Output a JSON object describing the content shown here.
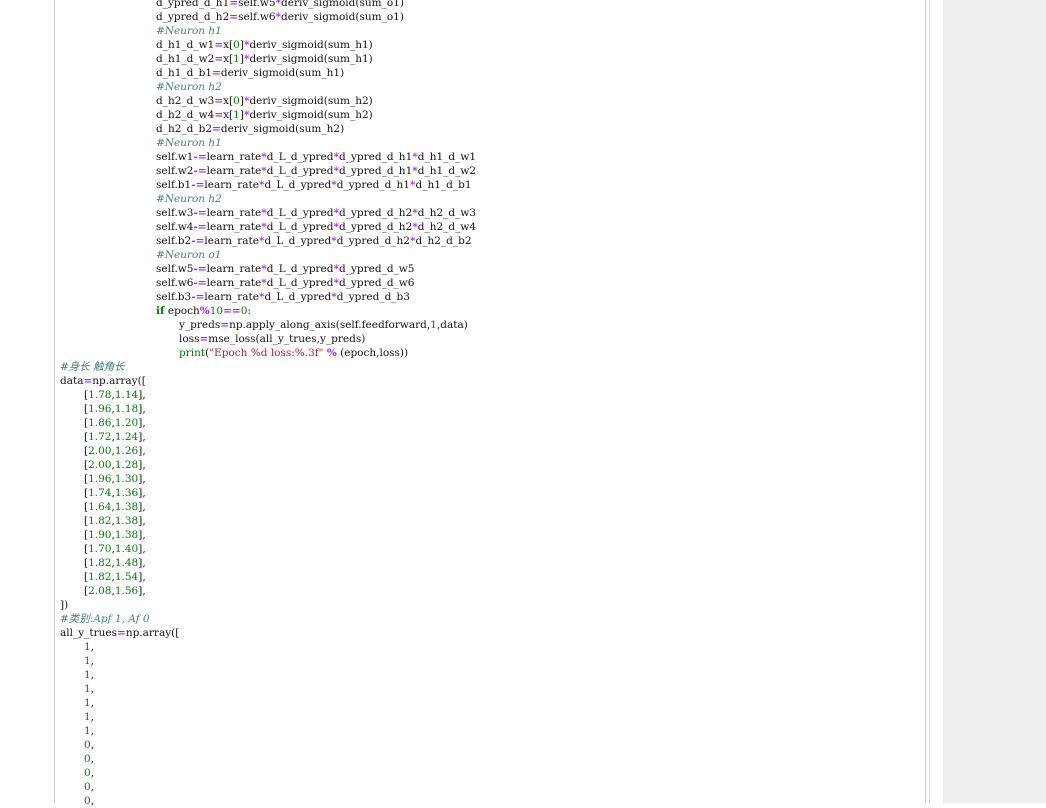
{
  "code_lines": [
    {
      "indent": 4,
      "tokens": [
        {
          "t": "d_ypred_d_h1",
          "c": ""
        },
        {
          "t": "=",
          "c": "op"
        },
        {
          "t": "self.w5",
          "c": ""
        },
        {
          "t": "*",
          "c": "op"
        },
        {
          "t": "deriv_sigmoid(sum_o1)",
          "c": ""
        }
      ]
    },
    {
      "indent": 4,
      "tokens": [
        {
          "t": "d_ypred_d_h2",
          "c": ""
        },
        {
          "t": "=",
          "c": "op"
        },
        {
          "t": "self.w6",
          "c": ""
        },
        {
          "t": "*",
          "c": "op"
        },
        {
          "t": "deriv_sigmoid(sum_o1)",
          "c": ""
        }
      ]
    },
    {
      "indent": 4,
      "tokens": [
        {
          "t": "#Neuron h1",
          "c": "cmt"
        }
      ]
    },
    {
      "indent": 4,
      "tokens": [
        {
          "t": "d_h1_d_w1",
          "c": ""
        },
        {
          "t": "=",
          "c": "op"
        },
        {
          "t": "x[",
          "c": ""
        },
        {
          "t": "0",
          "c": "num"
        },
        {
          "t": "]",
          "c": ""
        },
        {
          "t": "*",
          "c": "op"
        },
        {
          "t": "deriv_sigmoid(sum_h1)",
          "c": ""
        }
      ]
    },
    {
      "indent": 4,
      "tokens": [
        {
          "t": "d_h1_d_w2",
          "c": ""
        },
        {
          "t": "=",
          "c": "op"
        },
        {
          "t": "x[",
          "c": ""
        },
        {
          "t": "1",
          "c": "num"
        },
        {
          "t": "]",
          "c": ""
        },
        {
          "t": "*",
          "c": "op"
        },
        {
          "t": "deriv_sigmoid(sum_h1)",
          "c": ""
        }
      ]
    },
    {
      "indent": 4,
      "tokens": [
        {
          "t": "d_h1_d_b1",
          "c": ""
        },
        {
          "t": "=",
          "c": "op"
        },
        {
          "t": "deriv_sigmoid(sum_h1)",
          "c": ""
        }
      ]
    },
    {
      "indent": 4,
      "tokens": [
        {
          "t": "#Neuron h2",
          "c": "cmt"
        }
      ]
    },
    {
      "indent": 4,
      "tokens": [
        {
          "t": "d_h2_d_w3",
          "c": ""
        },
        {
          "t": "=",
          "c": "op"
        },
        {
          "t": "x[",
          "c": ""
        },
        {
          "t": "0",
          "c": "num"
        },
        {
          "t": "]",
          "c": ""
        },
        {
          "t": "*",
          "c": "op"
        },
        {
          "t": "deriv_sigmoid(sum_h2)",
          "c": ""
        }
      ]
    },
    {
      "indent": 4,
      "tokens": [
        {
          "t": "d_h2_d_w4",
          "c": ""
        },
        {
          "t": "=",
          "c": "op"
        },
        {
          "t": "x[",
          "c": ""
        },
        {
          "t": "1",
          "c": "num"
        },
        {
          "t": "]",
          "c": ""
        },
        {
          "t": "*",
          "c": "op"
        },
        {
          "t": "deriv_sigmoid(sum_h2)",
          "c": ""
        }
      ]
    },
    {
      "indent": 4,
      "tokens": [
        {
          "t": "d_h2_d_b2",
          "c": ""
        },
        {
          "t": "=",
          "c": "op"
        },
        {
          "t": "deriv_sigmoid(sum_h2)",
          "c": ""
        }
      ]
    },
    {
      "indent": 4,
      "tokens": [
        {
          "t": "#Neuron h1",
          "c": "cmt"
        }
      ]
    },
    {
      "indent": 4,
      "tokens": [
        {
          "t": "self.w1",
          "c": ""
        },
        {
          "t": "-=",
          "c": "op"
        },
        {
          "t": "learn_rate",
          "c": ""
        },
        {
          "t": "*",
          "c": "op"
        },
        {
          "t": "d_L_d_ypred",
          "c": ""
        },
        {
          "t": "*",
          "c": "op"
        },
        {
          "t": "d_ypred_d_h1",
          "c": ""
        },
        {
          "t": "*",
          "c": "op"
        },
        {
          "t": "d_h1_d_w1",
          "c": ""
        }
      ]
    },
    {
      "indent": 4,
      "tokens": [
        {
          "t": "self.w2",
          "c": ""
        },
        {
          "t": "-=",
          "c": "op"
        },
        {
          "t": "learn_rate",
          "c": ""
        },
        {
          "t": "*",
          "c": "op"
        },
        {
          "t": "d_L_d_ypred",
          "c": ""
        },
        {
          "t": "*",
          "c": "op"
        },
        {
          "t": "d_ypred_d_h1",
          "c": ""
        },
        {
          "t": "*",
          "c": "op"
        },
        {
          "t": "d_h1_d_w2",
          "c": ""
        }
      ]
    },
    {
      "indent": 4,
      "tokens": [
        {
          "t": "self.b1",
          "c": ""
        },
        {
          "t": "-=",
          "c": "op"
        },
        {
          "t": "learn_rate",
          "c": ""
        },
        {
          "t": "*",
          "c": "op"
        },
        {
          "t": "d_L_d_ypred",
          "c": ""
        },
        {
          "t": "*",
          "c": "op"
        },
        {
          "t": "d_ypred_d_h1",
          "c": ""
        },
        {
          "t": "*",
          "c": "op"
        },
        {
          "t": "d_h1_d_b1",
          "c": ""
        }
      ]
    },
    {
      "indent": 4,
      "tokens": [
        {
          "t": "#Neuron h2",
          "c": "cmt"
        }
      ]
    },
    {
      "indent": 4,
      "tokens": [
        {
          "t": "self.w3",
          "c": ""
        },
        {
          "t": "-=",
          "c": "op"
        },
        {
          "t": "learn_rate",
          "c": ""
        },
        {
          "t": "*",
          "c": "op"
        },
        {
          "t": "d_L_d_ypred",
          "c": ""
        },
        {
          "t": "*",
          "c": "op"
        },
        {
          "t": "d_ypred_d_h2",
          "c": ""
        },
        {
          "t": "*",
          "c": "op"
        },
        {
          "t": "d_h2_d_w3",
          "c": ""
        }
      ]
    },
    {
      "indent": 4,
      "tokens": [
        {
          "t": "self.w4",
          "c": ""
        },
        {
          "t": "-=",
          "c": "op"
        },
        {
          "t": "learn_rate",
          "c": ""
        },
        {
          "t": "*",
          "c": "op"
        },
        {
          "t": "d_L_d_ypred",
          "c": ""
        },
        {
          "t": "*",
          "c": "op"
        },
        {
          "t": "d_ypred_d_h2",
          "c": ""
        },
        {
          "t": "*",
          "c": "op"
        },
        {
          "t": "d_h2_d_w4",
          "c": ""
        }
      ]
    },
    {
      "indent": 4,
      "tokens": [
        {
          "t": "self.b2",
          "c": ""
        },
        {
          "t": "-=",
          "c": "op"
        },
        {
          "t": "learn_rate",
          "c": ""
        },
        {
          "t": "*",
          "c": "op"
        },
        {
          "t": "d_L_d_ypred",
          "c": ""
        },
        {
          "t": "*",
          "c": "op"
        },
        {
          "t": "d_ypred_d_h2",
          "c": ""
        },
        {
          "t": "*",
          "c": "op"
        },
        {
          "t": "d_h2_d_b2",
          "c": ""
        }
      ]
    },
    {
      "indent": 4,
      "tokens": [
        {
          "t": "#Neuron o1",
          "c": "cmt"
        }
      ]
    },
    {
      "indent": 4,
      "tokens": [
        {
          "t": "self.w5",
          "c": ""
        },
        {
          "t": "-=",
          "c": "op"
        },
        {
          "t": "learn_rate",
          "c": ""
        },
        {
          "t": "*",
          "c": "op"
        },
        {
          "t": "d_L_d_ypred",
          "c": ""
        },
        {
          "t": "*",
          "c": "op"
        },
        {
          "t": "d_ypred_d_w5",
          "c": ""
        }
      ]
    },
    {
      "indent": 4,
      "tokens": [
        {
          "t": "self.w6",
          "c": ""
        },
        {
          "t": "-=",
          "c": "op"
        },
        {
          "t": "learn_rate",
          "c": ""
        },
        {
          "t": "*",
          "c": "op"
        },
        {
          "t": "d_L_d_ypred",
          "c": ""
        },
        {
          "t": "*",
          "c": "op"
        },
        {
          "t": "d_ypred_d_w6",
          "c": ""
        }
      ]
    },
    {
      "indent": 4,
      "tokens": [
        {
          "t": "self.b3",
          "c": ""
        },
        {
          "t": "-=",
          "c": "op"
        },
        {
          "t": "learn_rate",
          "c": ""
        },
        {
          "t": "*",
          "c": "op"
        },
        {
          "t": "d_L_d_ypred",
          "c": ""
        },
        {
          "t": "*",
          "c": "op"
        },
        {
          "t": "d_ypred_d_b3",
          "c": ""
        }
      ]
    },
    {
      "indent": 4,
      "tokens": [
        {
          "t": "if",
          "c": "kw"
        },
        {
          "t": " epoch",
          "c": ""
        },
        {
          "t": "%",
          "c": "op"
        },
        {
          "t": "10",
          "c": "num"
        },
        {
          "t": "==",
          "c": "op"
        },
        {
          "t": "0",
          "c": "num"
        },
        {
          "t": ":",
          "c": ""
        }
      ]
    },
    {
      "indent": 5,
      "tokens": [
        {
          "t": "y_preds",
          "c": ""
        },
        {
          "t": "=",
          "c": "op"
        },
        {
          "t": "np.apply_along_axis(self.feedforward,",
          "c": ""
        },
        {
          "t": "1",
          "c": "num"
        },
        {
          "t": ",data)",
          "c": ""
        }
      ]
    },
    {
      "indent": 5,
      "tokens": [
        {
          "t": "loss",
          "c": ""
        },
        {
          "t": "=",
          "c": "op"
        },
        {
          "t": "mse_loss(all_y_trues,y_preds)",
          "c": ""
        }
      ]
    },
    {
      "indent": 5,
      "tokens": [
        {
          "t": "print",
          "c": "fn"
        },
        {
          "t": "(",
          "c": ""
        },
        {
          "t": "\"Epoch %d loss:%.3f\"",
          "c": "str"
        },
        {
          "t": " ",
          "c": ""
        },
        {
          "t": "%",
          "c": "op"
        },
        {
          "t": " (epoch,loss))",
          "c": ""
        }
      ]
    },
    {
      "indent": 0,
      "tokens": [
        {
          "t": "#身长 触角长",
          "c": "cmt"
        }
      ]
    },
    {
      "indent": 0,
      "tokens": [
        {
          "t": "data",
          "c": ""
        },
        {
          "t": "=",
          "c": "op"
        },
        {
          "t": "np.array([",
          "c": ""
        }
      ]
    },
    {
      "indent": 1,
      "tokens": [
        {
          "t": "[",
          "c": ""
        },
        {
          "t": "1.78",
          "c": "num"
        },
        {
          "t": ",",
          "c": ""
        },
        {
          "t": "1.14",
          "c": "num"
        },
        {
          "t": "],",
          "c": ""
        }
      ]
    },
    {
      "indent": 1,
      "tokens": [
        {
          "t": "[",
          "c": ""
        },
        {
          "t": "1.96",
          "c": "num"
        },
        {
          "t": ",",
          "c": ""
        },
        {
          "t": "1.18",
          "c": "num"
        },
        {
          "t": "],",
          "c": ""
        }
      ]
    },
    {
      "indent": 1,
      "tokens": [
        {
          "t": "[",
          "c": ""
        },
        {
          "t": "1.86",
          "c": "num"
        },
        {
          "t": ",",
          "c": ""
        },
        {
          "t": "1.20",
          "c": "num"
        },
        {
          "t": "],",
          "c": ""
        }
      ]
    },
    {
      "indent": 1,
      "tokens": [
        {
          "t": "[",
          "c": ""
        },
        {
          "t": "1.72",
          "c": "num"
        },
        {
          "t": ",",
          "c": ""
        },
        {
          "t": "1.24",
          "c": "num"
        },
        {
          "t": "],",
          "c": ""
        }
      ]
    },
    {
      "indent": 1,
      "tokens": [
        {
          "t": "[",
          "c": ""
        },
        {
          "t": "2.00",
          "c": "num"
        },
        {
          "t": ",",
          "c": ""
        },
        {
          "t": "1.26",
          "c": "num"
        },
        {
          "t": "],",
          "c": ""
        }
      ]
    },
    {
      "indent": 1,
      "tokens": [
        {
          "t": "[",
          "c": ""
        },
        {
          "t": "2.00",
          "c": "num"
        },
        {
          "t": ",",
          "c": ""
        },
        {
          "t": "1.28",
          "c": "num"
        },
        {
          "t": "],",
          "c": ""
        }
      ]
    },
    {
      "indent": 1,
      "tokens": [
        {
          "t": "[",
          "c": ""
        },
        {
          "t": "1.96",
          "c": "num"
        },
        {
          "t": ",",
          "c": ""
        },
        {
          "t": "1.30",
          "c": "num"
        },
        {
          "t": "],",
          "c": ""
        }
      ]
    },
    {
      "indent": 1,
      "tokens": [
        {
          "t": "[",
          "c": ""
        },
        {
          "t": "1.74",
          "c": "num"
        },
        {
          "t": ",",
          "c": ""
        },
        {
          "t": "1.36",
          "c": "num"
        },
        {
          "t": "],",
          "c": ""
        }
      ]
    },
    {
      "indent": 1,
      "tokens": [
        {
          "t": "[",
          "c": ""
        },
        {
          "t": "1.64",
          "c": "num"
        },
        {
          "t": ",",
          "c": ""
        },
        {
          "t": "1.38",
          "c": "num"
        },
        {
          "t": "],",
          "c": ""
        }
      ]
    },
    {
      "indent": 1,
      "tokens": [
        {
          "t": "[",
          "c": ""
        },
        {
          "t": "1.82",
          "c": "num"
        },
        {
          "t": ",",
          "c": ""
        },
        {
          "t": "1.38",
          "c": "num"
        },
        {
          "t": "],",
          "c": ""
        }
      ]
    },
    {
      "indent": 1,
      "tokens": [
        {
          "t": "[",
          "c": ""
        },
        {
          "t": "1.90",
          "c": "num"
        },
        {
          "t": ",",
          "c": ""
        },
        {
          "t": "1.38",
          "c": "num"
        },
        {
          "t": "],",
          "c": ""
        }
      ]
    },
    {
      "indent": 1,
      "tokens": [
        {
          "t": "[",
          "c": ""
        },
        {
          "t": "1.70",
          "c": "num"
        },
        {
          "t": ",",
          "c": ""
        },
        {
          "t": "1.40",
          "c": "num"
        },
        {
          "t": "],",
          "c": ""
        }
      ]
    },
    {
      "indent": 1,
      "tokens": [
        {
          "t": "[",
          "c": ""
        },
        {
          "t": "1.82",
          "c": "num"
        },
        {
          "t": ",",
          "c": ""
        },
        {
          "t": "1.48",
          "c": "num"
        },
        {
          "t": "],",
          "c": ""
        }
      ]
    },
    {
      "indent": 1,
      "tokens": [
        {
          "t": "[",
          "c": ""
        },
        {
          "t": "1.82",
          "c": "num"
        },
        {
          "t": ",",
          "c": ""
        },
        {
          "t": "1.54",
          "c": "num"
        },
        {
          "t": "],",
          "c": ""
        }
      ]
    },
    {
      "indent": 1,
      "tokens": [
        {
          "t": "[",
          "c": ""
        },
        {
          "t": "2.08",
          "c": "num"
        },
        {
          "t": ",",
          "c": ""
        },
        {
          "t": "1.56",
          "c": "num"
        },
        {
          "t": "],",
          "c": ""
        }
      ]
    },
    {
      "indent": 0,
      "tokens": [
        {
          "t": "])",
          "c": ""
        }
      ]
    },
    {
      "indent": 0,
      "tokens": [
        {
          "t": "#类别:Apf 1, Af 0",
          "c": "cmt"
        }
      ]
    },
    {
      "indent": 0,
      "tokens": [
        {
          "t": "all_y_trues",
          "c": ""
        },
        {
          "t": "=",
          "c": "op"
        },
        {
          "t": "np.array([",
          "c": ""
        }
      ]
    },
    {
      "indent": 1,
      "tokens": [
        {
          "t": "1",
          "c": "num"
        },
        {
          "t": ",",
          "c": ""
        }
      ]
    },
    {
      "indent": 1,
      "tokens": [
        {
          "t": "1",
          "c": "num"
        },
        {
          "t": ",",
          "c": ""
        }
      ]
    },
    {
      "indent": 1,
      "tokens": [
        {
          "t": "1",
          "c": "num"
        },
        {
          "t": ",",
          "c": ""
        }
      ]
    },
    {
      "indent": 1,
      "tokens": [
        {
          "t": "1",
          "c": "num"
        },
        {
          "t": ",",
          "c": ""
        }
      ]
    },
    {
      "indent": 1,
      "tokens": [
        {
          "t": "1",
          "c": "num"
        },
        {
          "t": ",",
          "c": ""
        }
      ]
    },
    {
      "indent": 1,
      "tokens": [
        {
          "t": "1",
          "c": "num"
        },
        {
          "t": ",",
          "c": ""
        }
      ]
    },
    {
      "indent": 1,
      "tokens": [
        {
          "t": "1",
          "c": "num"
        },
        {
          "t": ",",
          "c": ""
        }
      ]
    },
    {
      "indent": 1,
      "tokens": [
        {
          "t": "0",
          "c": "num"
        },
        {
          "t": ",",
          "c": ""
        }
      ]
    },
    {
      "indent": 1,
      "tokens": [
        {
          "t": "0",
          "c": "num"
        },
        {
          "t": ",",
          "c": ""
        }
      ]
    },
    {
      "indent": 1,
      "tokens": [
        {
          "t": "0",
          "c": "num"
        },
        {
          "t": ",",
          "c": ""
        }
      ]
    },
    {
      "indent": 1,
      "tokens": [
        {
          "t": "0",
          "c": "num"
        },
        {
          "t": ",",
          "c": ""
        }
      ]
    },
    {
      "indent": 1,
      "tokens": [
        {
          "t": "0",
          "c": "num"
        },
        {
          "t": ",",
          "c": ""
        }
      ]
    }
  ]
}
